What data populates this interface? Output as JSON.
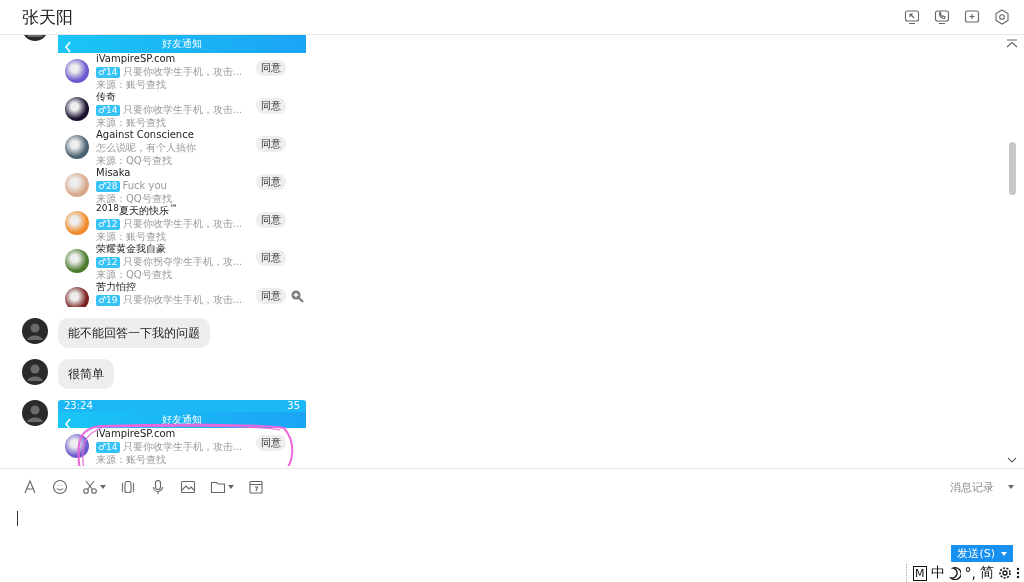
{
  "header": {
    "title": "张天阳"
  },
  "messages": [
    {
      "kind": "image",
      "screen": {
        "header_title": "好友通知",
        "requests": [
          {
            "name": "iVampireSP.com",
            "tag": "♂14",
            "message": "只要你收学生手机，攻击...",
            "source": "来源：账号查找",
            "button": "同意"
          },
          {
            "name": "传奇",
            "tag": "♂14",
            "message": "只要你收学生手机，攻击...",
            "source": "来源：账号查找",
            "button": "同意"
          },
          {
            "name": "Against Conscience",
            "message": "怎么说呢，有个人搞你",
            "source": "来源：QQ号查找",
            "button": "同意"
          },
          {
            "name": "Misaka",
            "tag": "♂28",
            "message": "Fuck you",
            "source": "来源：QQ号查找",
            "button": "同意"
          },
          {
            "name": "$^{2018}$夏天的快乐$^{™}$",
            "tag": "♂12",
            "message": "只要你收学生手机，攻击...",
            "source": "来源：账号查找",
            "button": "同意"
          },
          {
            "name": "荣耀黄金我自豪",
            "tag": "♂12",
            "message": "只要你拐夺学生手机，攻...",
            "source": "来源：QQ号查找",
            "button": "同意"
          },
          {
            "name": "苦力怕控",
            "tag": "♂19",
            "message": "只要你收学生手机，攻击...",
            "button": "同意"
          }
        ]
      }
    },
    {
      "kind": "text",
      "text": "能不能回答一下我的问题"
    },
    {
      "kind": "text",
      "text": "很简单"
    },
    {
      "kind": "image",
      "screen": {
        "status_time": "23:24",
        "status_battery": "35",
        "header_title": "好友通知",
        "annotated": true,
        "requests": [
          {
            "name": "iVampireSP.com",
            "tag": "♂14",
            "message": "只要你收学生手机，攻击...",
            "source": "来源：账号查找",
            "button": "同意"
          }
        ]
      }
    }
  ],
  "composer": {
    "history_label": "消息记录",
    "send_label": "发送(S)"
  },
  "ime": {
    "items": [
      {
        "kind": "boxed",
        "label": "M"
      },
      {
        "kind": "text",
        "label": "中"
      },
      {
        "kind": "moon"
      },
      {
        "kind": "text",
        "label": "°,"
      },
      {
        "kind": "text",
        "label": "简"
      },
      {
        "kind": "gear"
      },
      {
        "kind": "dots"
      }
    ]
  }
}
